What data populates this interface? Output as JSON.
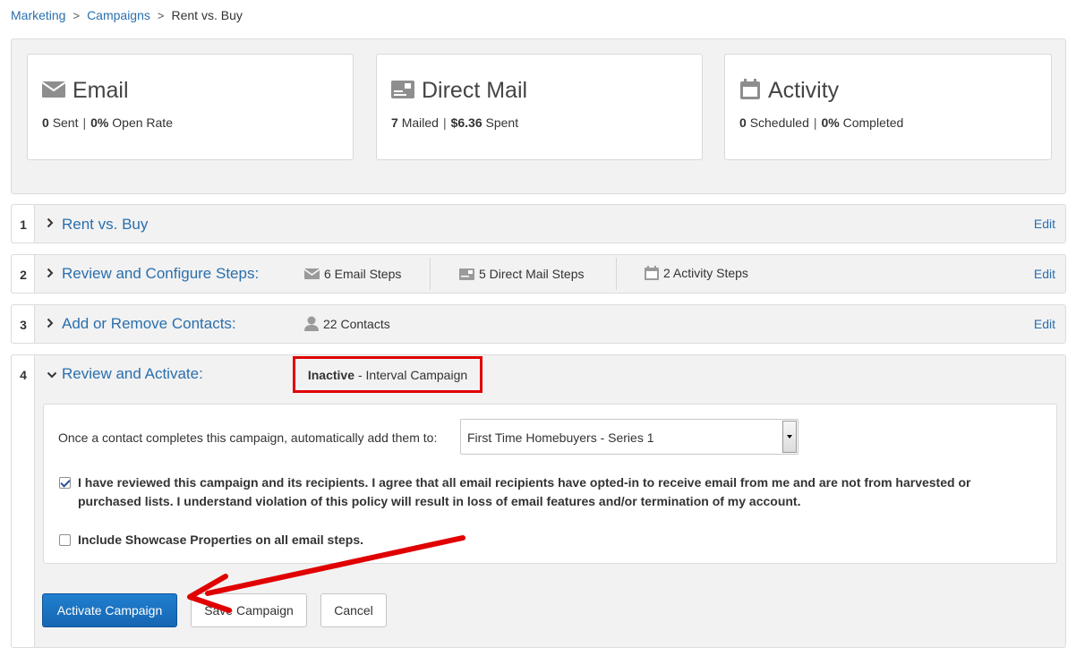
{
  "breadcrumb": {
    "items": [
      "Marketing",
      "Campaigns"
    ],
    "separator": ">",
    "current": "Rent vs. Buy"
  },
  "stats": {
    "email": {
      "title": "Email",
      "sent": "0",
      "sent_label": "Sent",
      "rate": "0%",
      "rate_label": "Open Rate",
      "icon": "envelope-icon"
    },
    "direct_mail": {
      "title": "Direct Mail",
      "mailed": "7",
      "mailed_label": "Mailed",
      "spent": "$6.36",
      "spent_label": "Spent",
      "icon": "mail-card-icon"
    },
    "activity": {
      "title": "Activity",
      "scheduled": "0",
      "scheduled_label": "Scheduled",
      "completed": "0%",
      "completed_label": "Completed",
      "icon": "calendar-icon"
    },
    "bar": "|"
  },
  "steps": [
    {
      "num": "1",
      "title": "Rent vs. Buy",
      "edit": "Edit"
    },
    {
      "num": "2",
      "title": "Review and Configure Steps:",
      "edit": "Edit",
      "email_steps": "6 Email Steps",
      "mail_steps": "5 Direct Mail Steps",
      "activity_steps": "2 Activity Steps"
    },
    {
      "num": "3",
      "title": "Add or Remove Contacts:",
      "edit": "Edit",
      "contacts": "22 Contacts"
    },
    {
      "num": "4",
      "title": "Review and Activate:",
      "status": "Inactive",
      "status_detail": "- Interval Campaign"
    }
  ],
  "review": {
    "auto_add_label": "Once a contact completes this campaign, automatically add them to:",
    "auto_add_value": "First Time Homebuyers - Series 1",
    "agree_line1": "I have reviewed this campaign and its recipients. I agree that all email recipients have opted-in to receive email from me and are not from harvested or",
    "agree_line2": "purchased lists. I understand violation of this policy will result in loss of email features and/or termination of my account.",
    "agree_checked": true,
    "showcase_label": "Include Showcase Properties on all email steps.",
    "showcase_checked": false
  },
  "buttons": {
    "activate": "Activate Campaign",
    "save": "Save Campaign",
    "cancel": "Cancel"
  },
  "colors": {
    "link": "#2a6fad",
    "primary": "#1766b2",
    "highlight": "#e00000"
  }
}
